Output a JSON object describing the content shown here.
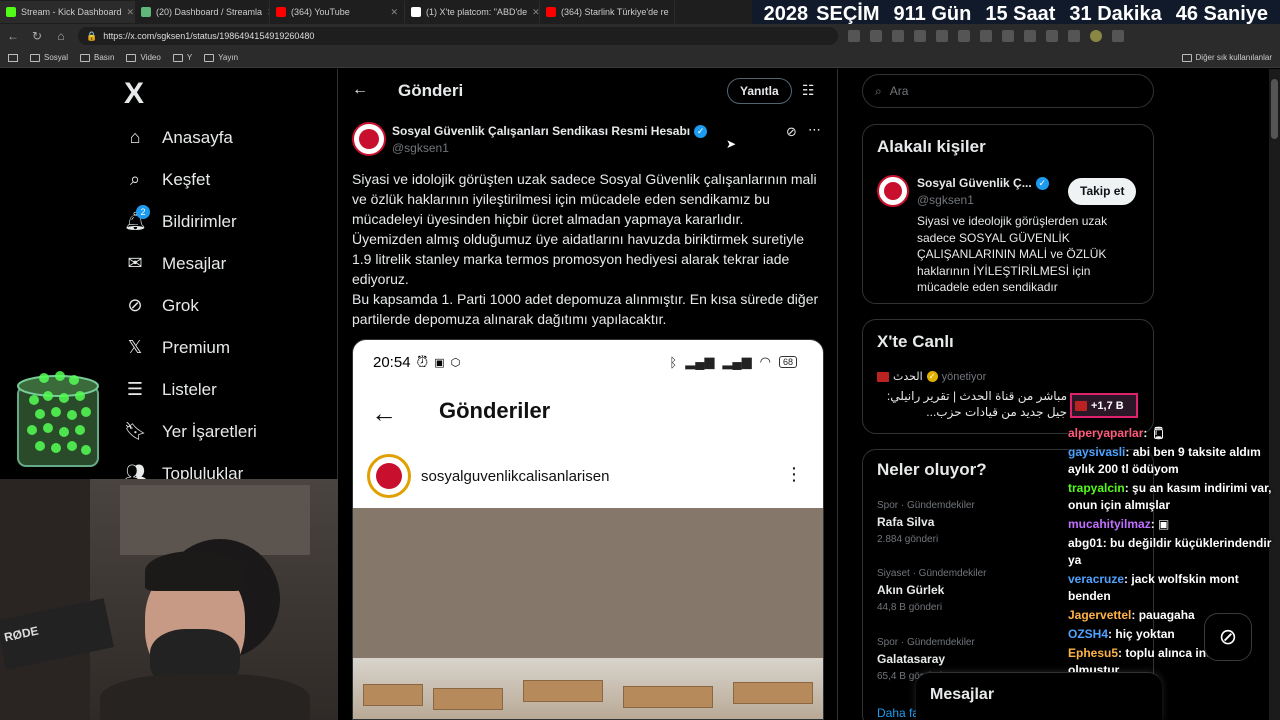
{
  "browser": {
    "tabs": [
      {
        "title": "Stream - Kick Dashboard",
        "color": "#53fc18"
      },
      {
        "title": "(20) Dashboard / Streamla",
        "color": "#5fb878"
      },
      {
        "title": "(364) YouTube",
        "color": "#ff0000"
      },
      {
        "title": "(1) X'te platcom: \"ABD'de",
        "color": "#ffffff"
      },
      {
        "title": "(364) Starlink Türkiye'de re",
        "color": "#ff0000"
      }
    ],
    "url": "https://x.com/sgksen1/status/1986494154919260480",
    "bookmarks": [
      "Sosyal",
      "Basın",
      "Video",
      "Y",
      "Yayın"
    ],
    "other_bookmarks": "Diğer sık kullanılanlar"
  },
  "countdown": {
    "year": "2028",
    "label": "SEÇİM",
    "days": "911",
    "days_label": "Gün",
    "hours": "15",
    "hours_label": "Saat",
    "minutes": "31",
    "minutes_label": "Dakika",
    "seconds": "46",
    "seconds_label": "Saniye"
  },
  "nav": {
    "logo": "X",
    "items": [
      {
        "label": "Anasayfa",
        "icon": "home-icon"
      },
      {
        "label": "Keşfet",
        "icon": "search-icon"
      },
      {
        "label": "Bildirimler",
        "icon": "bell-icon",
        "badge": "2"
      },
      {
        "label": "Mesajlar",
        "icon": "mail-icon"
      },
      {
        "label": "Grok",
        "icon": "grok-icon"
      },
      {
        "label": "Premium",
        "icon": "x-icon"
      },
      {
        "label": "Listeler",
        "icon": "list-icon"
      },
      {
        "label": "Yer İşaretleri",
        "icon": "bookmark-icon"
      },
      {
        "label": "Topluluklar",
        "icon": "people-icon"
      }
    ]
  },
  "post": {
    "header_title": "Gönderi",
    "reply_label": "Yanıtla",
    "author": "Sosyal Güvenlik Çalışanları Sendikası Resmi Hesabı",
    "handle": "@sgksen1",
    "body": [
      "Siyasi ve idolojik görüşten uzak sadece Sosyal Güvenlik çalışanlarının mali ve özlük haklarının iyileştirilmesi için mücadele eden sendikamız bu mücadeleyi üyesinden hiçbir ücret almadan yapmaya kararlıdır.",
      "Üyemizden almış olduğumuz üye aidatlarını havuzda biriktirmek suretiyle 1.9 litrelik  stanley marka termos promosyon hediyesi alarak tekrar iade ediyoruz.",
      "Bu kapsamda 1. Parti 1000 adet depomuza alınmıştır. En kısa sürede diğer partilerde depomuza alınarak dağıtımı yapılacaktır."
    ],
    "media": {
      "time": "20:54",
      "battery": "68",
      "title": "Gönderiler",
      "username": "sosyalguvenlikcalisanlarisen"
    }
  },
  "right": {
    "search_placeholder": "Ara",
    "related_title": "Alakalı kişiler",
    "related": {
      "name": "Sosyal Güvenlik Ç...",
      "handle": "@sgksen1",
      "follow_label": "Takip et",
      "bio": "Siyasi ve ideolojik görüşlerden uzak sadece SOSYAL GÜVENLİK ÇALIŞANLARININ MALİ ve ÖZLÜK haklarının İYİLEŞTİRİLMESİ için mücadele eden sendikadır"
    },
    "live_title": "X'te Canlı",
    "live": {
      "source": "الحدث",
      "role": "yönetiyor",
      "text": "مباشر من قناة الحدث | تقرير رانيلي: جيل جديد من قيادات حزب..."
    },
    "trends_title": "Neler oluyor?",
    "trends": [
      {
        "category": "Spor · Gündemdekiler",
        "name": "Rafa Silva",
        "count": "2.884 gönderi"
      },
      {
        "category": "Siyaset · Gündemdekiler",
        "name": "Akın Gürlek",
        "count": "44,8 B gönderi"
      },
      {
        "category": "Spor · Gündemdekiler",
        "name": "Galatasaray",
        "count": "65,4 B gönderi"
      }
    ],
    "more_label": "Daha fa"
  },
  "chat": {
    "top_badge": "+1,7 B",
    "messages": [
      {
        "user": "alperyaparlar",
        "text": "",
        "color": "#ff5b7a"
      },
      {
        "user": "gaysivasli",
        "text": "abi ben 9 taksite aldım aylık 200 tl ödüyom",
        "color": "#4fa3ff"
      },
      {
        "user": "trapyalcin",
        "text": "şu an kasım indirimi var, onun için almışlar",
        "color": "#53fc18"
      },
      {
        "user": "mucahityilmaz",
        "text": "",
        "color": "#c070ff"
      },
      {
        "user": "abg01",
        "text": "bu değildir küçüklerindendir ya",
        "color": "#ffffff"
      },
      {
        "user": "veracruze",
        "text": "jack wolfskin mont benden",
        "color": "#4fa3ff"
      },
      {
        "user": "Jagervettel",
        "text": "pauagaha",
        "color": "#ffb347"
      },
      {
        "user": "OZSH4",
        "text": "hiç yoktan",
        "color": "#4fa3ff"
      },
      {
        "user": "Ephesu5",
        "text": "toplu alınca indirim olmuştur",
        "color": "#ffb347"
      }
    ]
  },
  "dm": {
    "label": "Mesajlar"
  }
}
